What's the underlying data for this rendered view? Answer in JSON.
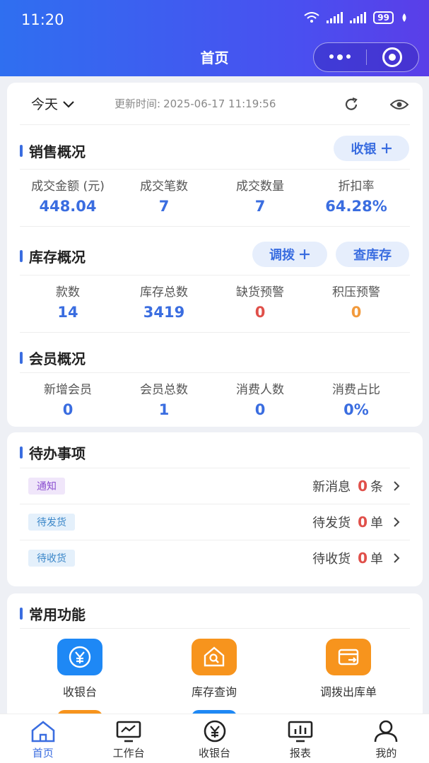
{
  "status_bar": {
    "time": "11:20",
    "battery": "99"
  },
  "header": {
    "title": "首页"
  },
  "toolbar": {
    "date_filter": "今天",
    "update_label": "更新时间:",
    "update_time": "2025-06-17 11:19:56"
  },
  "sales": {
    "title": "销售概况",
    "action_label": "收银",
    "stats": [
      {
        "label": "成交金额 (元)",
        "value": "448.04"
      },
      {
        "label": "成交笔数",
        "value": "7"
      },
      {
        "label": "成交数量",
        "value": "7"
      },
      {
        "label": "折扣率",
        "value": "64.28%"
      }
    ]
  },
  "inventory": {
    "title": "库存概况",
    "transfer_label": "调拨",
    "query_label": "查库存",
    "stats": [
      {
        "label": "款数",
        "value": "14"
      },
      {
        "label": "库存总数",
        "value": "3419"
      },
      {
        "label": "缺货预警",
        "value": "0"
      },
      {
        "label": "积压预警",
        "value": "0"
      }
    ]
  },
  "members": {
    "title": "会员概况",
    "stats": [
      {
        "label": "新增会员",
        "value": "0"
      },
      {
        "label": "会员总数",
        "value": "1"
      },
      {
        "label": "消费人数",
        "value": "0"
      },
      {
        "label": "消费占比",
        "value": "0%"
      }
    ]
  },
  "todo": {
    "title": "待办事项",
    "items": [
      {
        "tag": "通知",
        "text": "新消息",
        "count": "0",
        "unit": "条"
      },
      {
        "tag": "待发货",
        "text": "待发货",
        "count": "0",
        "unit": "单"
      },
      {
        "tag": "待收货",
        "text": "待收货",
        "count": "0",
        "unit": "单"
      }
    ]
  },
  "functions": {
    "title": "常用功能",
    "items": [
      {
        "label": "收银台",
        "icon": "yen-icon",
        "color": "#1e88f5"
      },
      {
        "label": "库存查询",
        "icon": "house-search-icon",
        "color": "#f7941d"
      },
      {
        "label": "调拨出库单",
        "icon": "transfer-card-icon",
        "color": "#f7941d"
      }
    ]
  },
  "tabbar": {
    "items": [
      {
        "label": "首页",
        "icon": "home-icon"
      },
      {
        "label": "工作台",
        "icon": "monitor-icon"
      },
      {
        "label": "收银台",
        "icon": "yen-circle-icon"
      },
      {
        "label": "报表",
        "icon": "chart-icon"
      },
      {
        "label": "我的",
        "icon": "user-icon"
      }
    ]
  },
  "colors": {
    "accent": "#3a6de0",
    "warning_red": "#e0504a",
    "warning_orange": "#f29a3c"
  }
}
